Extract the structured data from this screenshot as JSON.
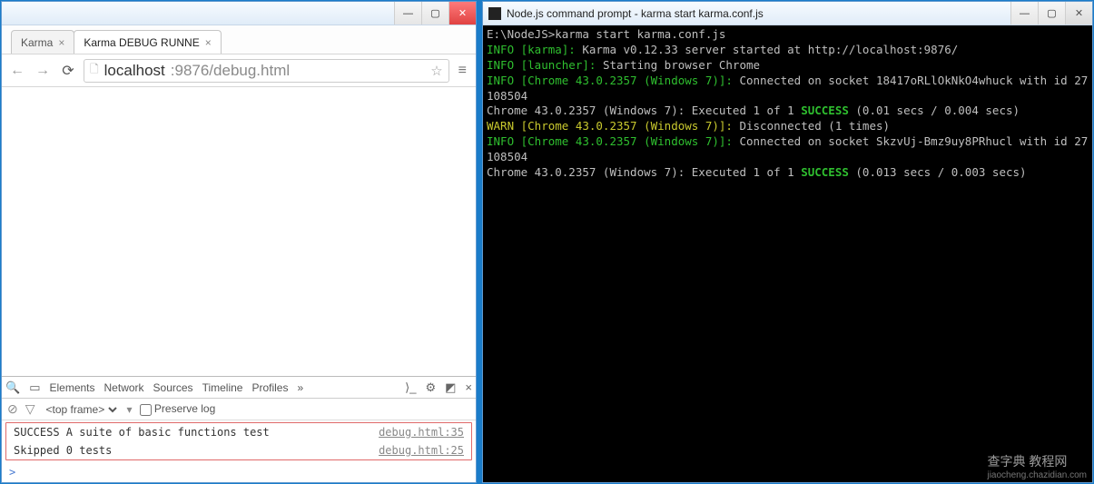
{
  "chrome": {
    "win_min": "—",
    "win_max": "▢",
    "win_close": "✕",
    "tabs": [
      {
        "title": "Karma",
        "active": false
      },
      {
        "title": "Karma DEBUG RUNNE",
        "active": true
      }
    ],
    "tab_close": "×",
    "url_host": "localhost",
    "url_path": ":9876/debug.html",
    "star": "☆",
    "menu": "≡"
  },
  "devtools": {
    "tabs": [
      "Elements",
      "Network",
      "Sources",
      "Timeline",
      "Profiles"
    ],
    "more": "»",
    "frame_selector": "<top frame>",
    "preserve_label": "Preserve log",
    "console": [
      {
        "msg": "SUCCESS A suite of basic functions test",
        "src": "debug.html:35"
      },
      {
        "msg": "Skipped 0 tests",
        "src": "debug.html:25"
      }
    ],
    "prompt": ">"
  },
  "cmd": {
    "title": "Node.js command prompt - karma  start karma.conf.js",
    "win_min": "—",
    "win_max": "▢",
    "win_close": "✕",
    "lines": [
      {
        "segs": [
          {
            "t": "E:\\NodeJS>karma start karma.conf.js"
          }
        ]
      },
      {
        "segs": [
          {
            "t": "INFO [karma]:",
            "c": "g"
          },
          {
            "t": " Karma v0.12.33 server started at http://localhost:9876/"
          }
        ]
      },
      {
        "segs": [
          {
            "t": "INFO [launcher]:",
            "c": "g"
          },
          {
            "t": " Starting browser Chrome"
          }
        ]
      },
      {
        "segs": [
          {
            "t": "INFO [Chrome 43.0.2357 (Windows 7)]:",
            "c": "g"
          },
          {
            "t": " Connected on socket 18417oRLlOkNkO4whuck with id 27108504"
          }
        ]
      },
      {
        "segs": [
          {
            "t": "Chrome 43.0.2357 (Windows 7): Executed 1 of 1 "
          },
          {
            "t": "SUCCESS",
            "c": "gb"
          },
          {
            "t": " (0.01 secs / 0.004 secs)"
          }
        ]
      },
      {
        "segs": [
          {
            "t": "WARN [Chrome 43.0.2357 (Windows 7)]:",
            "c": "y"
          },
          {
            "t": " Disconnected (1 times)"
          }
        ]
      },
      {
        "segs": [
          {
            "t": "INFO [Chrome 43.0.2357 (Windows 7)]:",
            "c": "g"
          },
          {
            "t": " Connected on socket SkzvUj-Bmz9uy8PRhucl with id 27108504"
          }
        ]
      },
      {
        "segs": [
          {
            "t": "Chrome 43.0.2357 (Windows 7): Executed 1 of 1 "
          },
          {
            "t": "SUCCESS",
            "c": "gb"
          },
          {
            "t": " (0.013 secs / 0.003 secs)"
          }
        ]
      }
    ]
  },
  "watermark": {
    "main": "查字典 教程网",
    "sub": "jiaocheng.chazidian.com"
  }
}
